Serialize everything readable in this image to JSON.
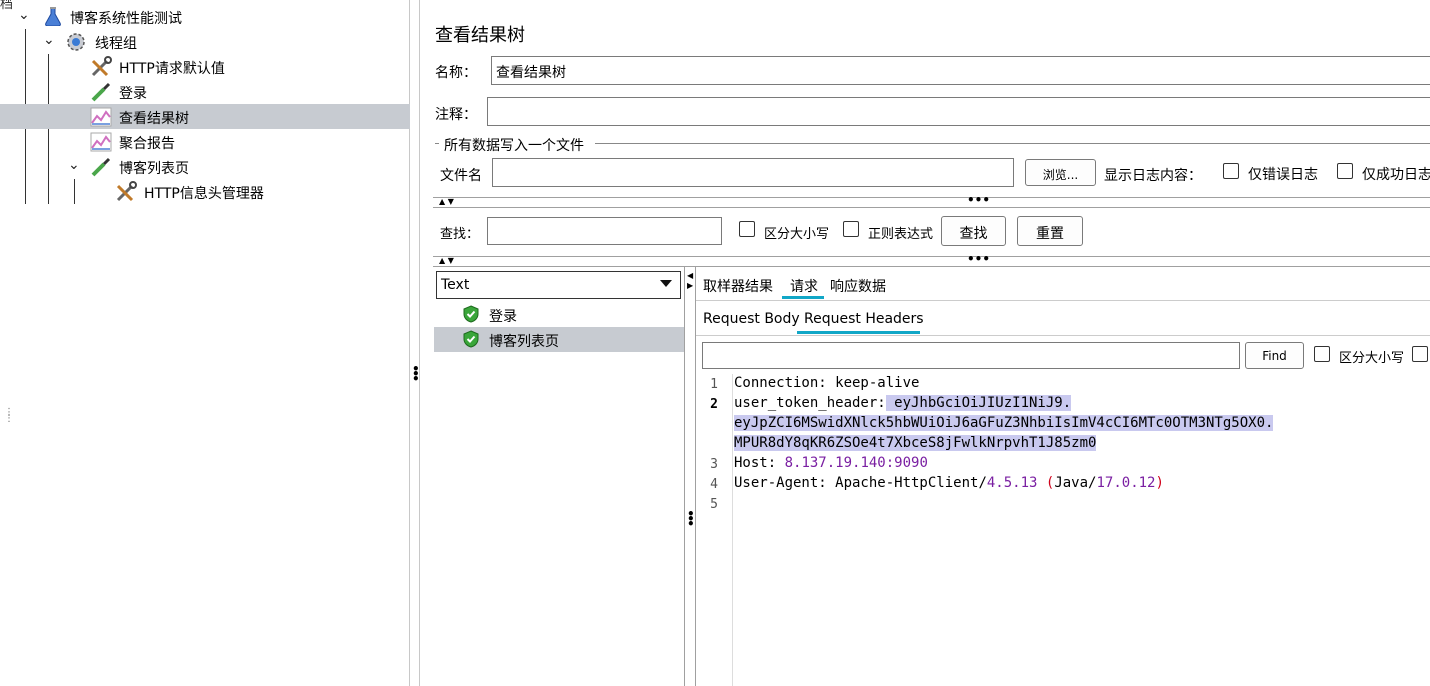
{
  "tree": {
    "top_cut_label": "档",
    "items": [
      {
        "label": "博客系统性能测试",
        "icon": "flask-icon"
      },
      {
        "label": "线程组",
        "icon": "gear-icon"
      },
      {
        "label": "HTTP请求默认值",
        "icon": "wrench-icon"
      },
      {
        "label": "登录",
        "icon": "pipette-icon"
      },
      {
        "label": "查看结果树",
        "icon": "chart-icon"
      },
      {
        "label": "聚合报告",
        "icon": "chart-icon"
      },
      {
        "label": "博客列表页",
        "icon": "pipette-icon"
      },
      {
        "label": "HTTP信息头管理器",
        "icon": "wrench-icon"
      }
    ]
  },
  "panel": {
    "title": "查看结果树",
    "name_label": "名称：",
    "name_value": "查看结果树",
    "comment_label": "注释：",
    "comment_value": "",
    "file_group_label": "所有数据写入一个文件",
    "filename_label": "文件名",
    "filename_value": "",
    "browse_button": "浏览...",
    "log_content_label": "显示日志内容：",
    "errors_only_label": "仅错误日志",
    "success_only_label": "仅成功日志",
    "search_label": "查找：",
    "search_value": "",
    "case_sensitive_label": "区分大小写",
    "regex_label": "正则表达式",
    "find_button": "查找",
    "reset_button": "重置"
  },
  "results": {
    "renderer_select": "Text",
    "samples": [
      {
        "label": "登录",
        "status": "success"
      },
      {
        "label": "博客列表页",
        "status": "success"
      }
    ]
  },
  "detail": {
    "tabs": [
      "取样器结果",
      "请求",
      "响应数据"
    ],
    "active_tab": "请求",
    "subtabs": [
      "Request Body",
      "Request Headers"
    ],
    "active_subtab": "Request Headers",
    "find_value": "",
    "find_button": "Find",
    "case_label": "区分大小写",
    "line_numbers": [
      "1",
      "2",
      "3",
      "4",
      "5"
    ],
    "code": {
      "l1_key": "Connection:",
      "l1_val": " keep-alive",
      "l2_key": "user_token_header:",
      "l2_val": " eyJhbGciOiJIUzI1NiJ9.",
      "l2b": "eyJpZCI6MSwidXNlck5hbWUiOiJ6aGFuZ3NhbiIsImV4cCI6MTc0OTM3NTg5OX0.",
      "l2c": "MPUR8dY8qKR6ZSOe4t7XbceS8jFwlkNrpvhT1J85zm0",
      "l3_key": "Host:",
      "l3_val": " 8.137.19.140:9090",
      "l4_key": "User-Agent:",
      "l4_a": " Apache-HttpClient",
      "l4_slash1": "/",
      "l4_ver": "4.5.13",
      "l4_sp": " ",
      "l4_po": "(",
      "l4_java": "Java",
      "l4_slash2": "/",
      "l4_jver": "17.0.12",
      "l4_pc": ")"
    }
  },
  "colors": {
    "accent": "#11a7c7",
    "selection": "#c7cbd1",
    "highlight": "#c9c9ef",
    "number": "#7a1fa2"
  }
}
